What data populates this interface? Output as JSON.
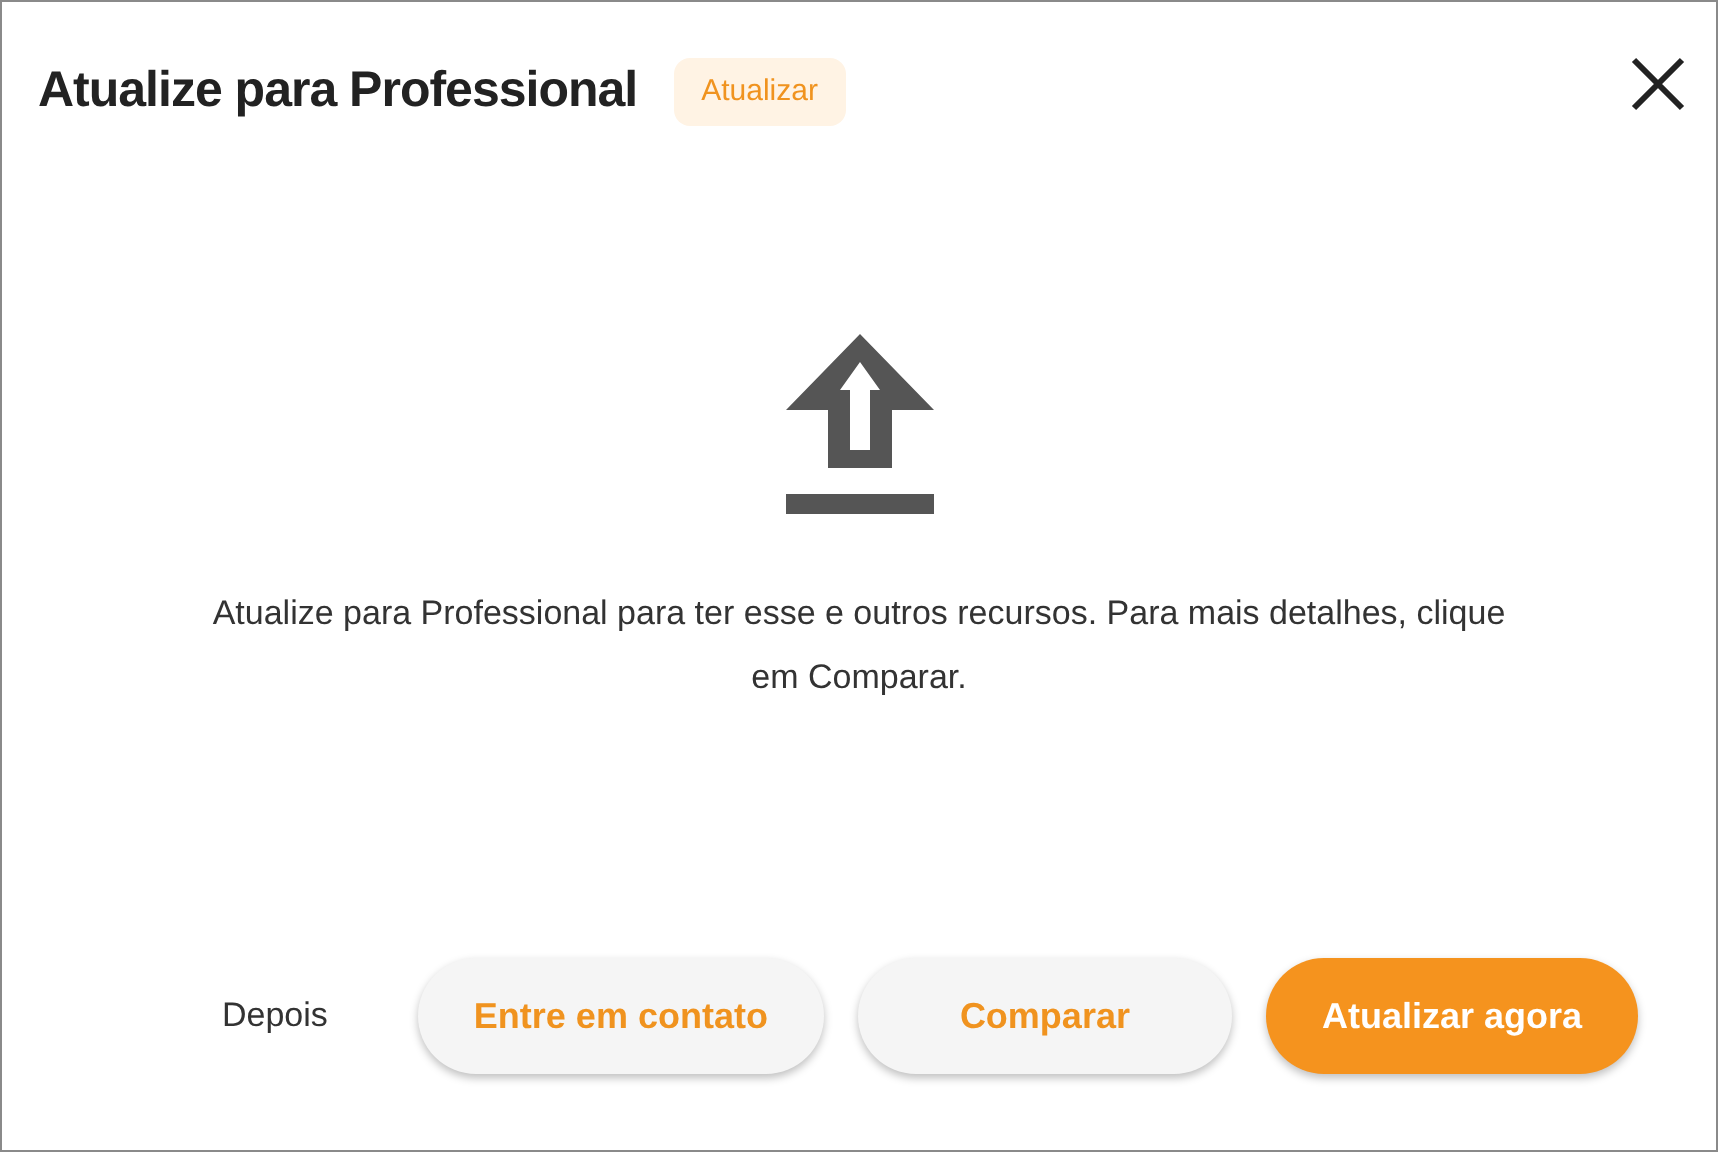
{
  "dialog": {
    "title": "Atualize para Professional",
    "badge": "Atualizar",
    "message": "Atualize para Professional para ter esse e outros recursos. Para mais detalhes, clique em Comparar."
  },
  "buttons": [
    {
      "label": "Depois",
      "kind": "text"
    },
    {
      "label": "Entre em contato",
      "kind": "secondary"
    },
    {
      "label": "Comparar",
      "kind": "secondary"
    },
    {
      "label": "Atualizar agora",
      "kind": "primary"
    }
  ]
}
